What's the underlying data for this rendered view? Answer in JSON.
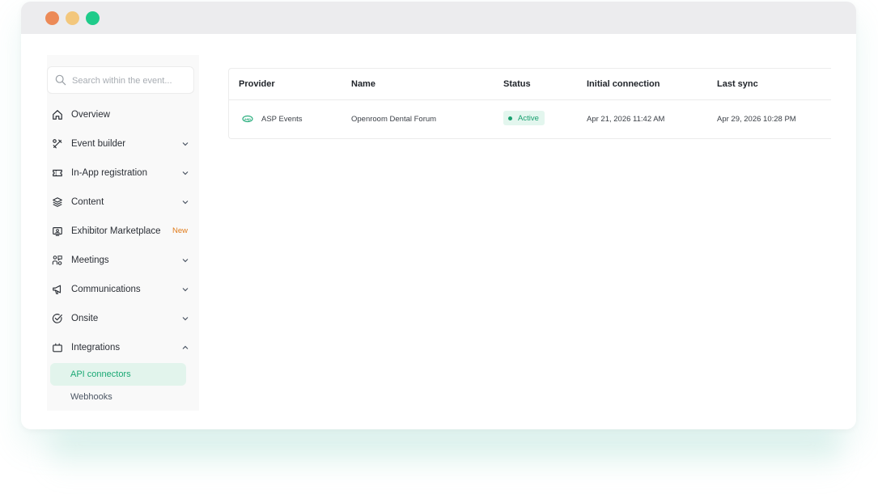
{
  "window": {
    "controls": [
      {
        "name": "close",
        "color": "#ec8a57"
      },
      {
        "name": "minimize",
        "color": "#f3c77c"
      },
      {
        "name": "maximize",
        "color": "#1fcb8a"
      }
    ]
  },
  "sidebar": {
    "search": {
      "placeholder": "Search within the event...",
      "value": ""
    },
    "items": [
      {
        "label": "Overview",
        "icon": "home-icon",
        "expandable": false
      },
      {
        "label": "Event builder",
        "icon": "tools-icon",
        "expandable": true
      },
      {
        "label": "In-App registration",
        "icon": "ticket-icon",
        "expandable": true
      },
      {
        "label": "Content",
        "icon": "layers-icon",
        "expandable": true
      },
      {
        "label": "Exhibitor Marketplace",
        "icon": "storefront-icon",
        "expandable": false,
        "badge": "New"
      },
      {
        "label": "Meetings",
        "icon": "meetings-icon",
        "expandable": true
      },
      {
        "label": "Communications",
        "icon": "megaphone-icon",
        "expandable": true
      },
      {
        "label": "Onsite",
        "icon": "badge-check-icon",
        "expandable": true
      },
      {
        "label": "Integrations",
        "icon": "plug-icon",
        "expandable": true,
        "expanded": true
      }
    ],
    "sub_items": [
      {
        "label": "API connectors",
        "active": true
      },
      {
        "label": "Webhooks",
        "active": false
      }
    ],
    "accent_color": "#1aa874",
    "badge_color": "#e07b1a"
  },
  "table": {
    "columns": [
      "Provider",
      "Name",
      "Status",
      "Initial connection",
      "Last sync"
    ],
    "rows": [
      {
        "provider": "ASP Events",
        "provider_icon": "asp-logo-icon",
        "name": "Openroom Dental Forum",
        "status": "Active",
        "initial_connection": "Apr 21, 2026 11:42 AM",
        "last_sync": "Apr 29, 2026 10:28 PM"
      }
    ],
    "status_color": "#18a06f"
  }
}
